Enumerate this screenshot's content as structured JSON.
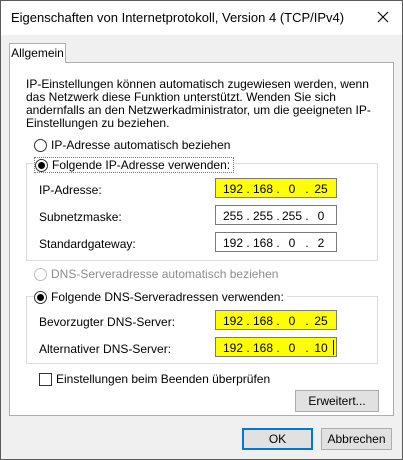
{
  "window": {
    "title": "Eigenschaften von Internetprotokoll, Version 4 (TCP/IPv4)"
  },
  "tab": {
    "label": "Allgemein"
  },
  "description": "IP-Einstellungen können automatisch zugewiesen werden, wenn das Netzwerk diese Funktion unterstützt. Wenden Sie sich andernfalls an den Netzwerkadministrator, um die geeigneten IP-Einstellungen zu beziehen.",
  "ip_section": {
    "auto_label": "IP-Adresse automatisch beziehen",
    "manual_label": "Folgende IP-Adresse verwenden:",
    "selected": "manual",
    "fields": [
      {
        "label": "IP-Adresse:",
        "octets": [
          "192",
          "168",
          "0",
          "25"
        ],
        "highlighted": true
      },
      {
        "label": "Subnetzmaske:",
        "octets": [
          "255",
          "255",
          "255",
          "0"
        ],
        "highlighted": false
      },
      {
        "label": "Standardgateway:",
        "octets": [
          "192",
          "168",
          "0",
          "2"
        ],
        "highlighted": false
      }
    ]
  },
  "dns_section": {
    "auto_label": "DNS-Serveradresse automatisch beziehen",
    "auto_disabled": true,
    "manual_label": "Folgende DNS-Serveradressen verwenden:",
    "selected": "manual",
    "fields": [
      {
        "label": "Bevorzugter DNS-Server:",
        "octets": [
          "192",
          "168",
          "0",
          "25"
        ],
        "highlighted": true
      },
      {
        "label": "Alternativer DNS-Server:",
        "octets": [
          "192",
          "168",
          "0",
          "10"
        ],
        "highlighted": true
      }
    ]
  },
  "validate_checkbox": {
    "label": "Einstellungen beim Beenden überprüfen",
    "checked": false
  },
  "buttons": {
    "advanced": "Erweitert...",
    "ok": "OK",
    "cancel": "Abbrechen"
  },
  "icons": {
    "close": "close-icon"
  },
  "colors": {
    "highlight": "#ffff00",
    "default_button_border": "#0078d7"
  }
}
